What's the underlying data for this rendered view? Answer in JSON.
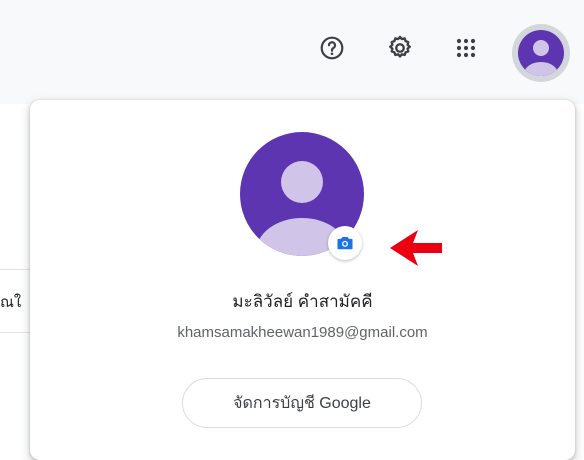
{
  "header": {
    "icons": [
      "help-icon",
      "gear-icon",
      "apps-grid-icon",
      "account-avatar-icon"
    ]
  },
  "background": {
    "partial_text": "ณใ"
  },
  "account_panel": {
    "user_name": "มะลิวัลย์ คำสามัคคี",
    "email": "khamsamakheewan1989@gmail.com",
    "manage_button_label": "จัดการบัญชี Google",
    "camera_icon": "camera-icon",
    "arrow_icon": "red-arrow-icon"
  },
  "colors": {
    "avatar_bg": "#5e35b1",
    "avatar_figure": "#d1c4e9",
    "camera_blue": "#1a73e8",
    "arrow_red": "#ea0010",
    "icon_gray": "#5f6368"
  }
}
